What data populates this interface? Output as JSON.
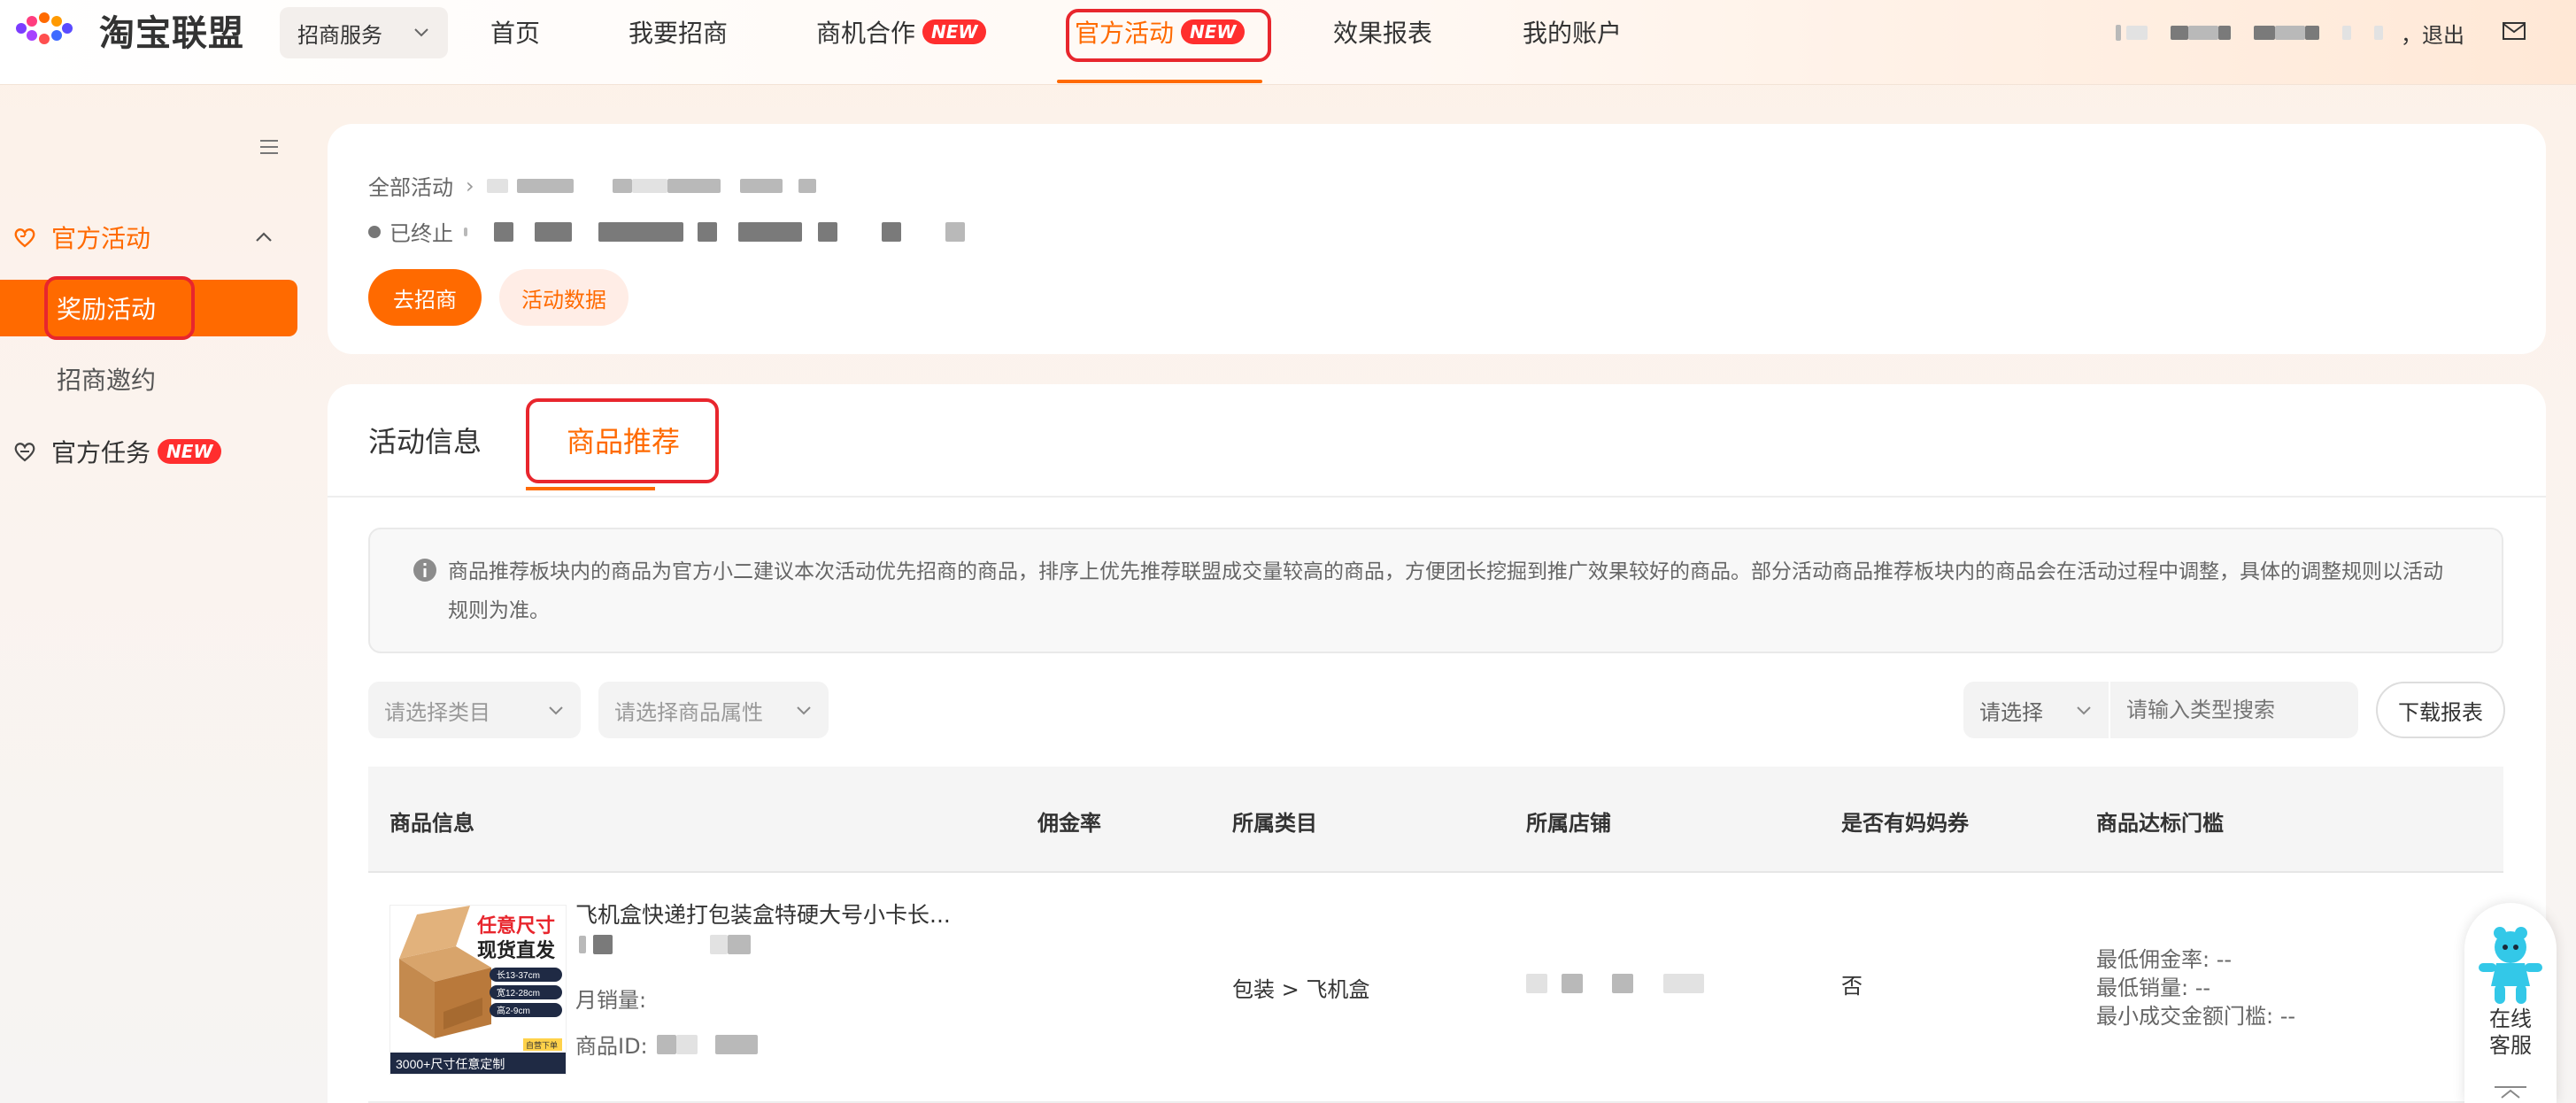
{
  "header": {
    "logo_text": "淘宝联盟",
    "service_select": "招商服务",
    "nav": [
      {
        "label": "首页"
      },
      {
        "label": "我要招商"
      },
      {
        "label": "商机合作",
        "badge": "NEW"
      },
      {
        "label": "官方活动",
        "badge": "NEW"
      },
      {
        "label": "效果报表"
      },
      {
        "label": "我的账户"
      }
    ],
    "logout": "，退出"
  },
  "sidebar": {
    "groups": [
      {
        "label": "官方活动",
        "items": [
          "奖励活动",
          "招商邀约"
        ]
      },
      {
        "label": "官方任务",
        "badge": "NEW"
      }
    ]
  },
  "activity": {
    "breadcrumb_root": "全部活动",
    "status": "已终止",
    "primary_button": "去招商",
    "secondary_button": "活动数据"
  },
  "tabs": [
    "活动信息",
    "商品推荐"
  ],
  "notice": "商品推荐板块内的商品为官方小二建议本次活动优先招商的商品，排序上优先推荐联盟成交量较高的商品，方便团长挖掘到推广效果较好的商品。部分活动商品推荐板块内的商品会在活动过程中调整，具体的调整规则以活动规则为准。",
  "filters": {
    "category_placeholder": "请选择类目",
    "attribute_placeholder": "请选择商品属性",
    "type_select": "请选择",
    "search_placeholder": "请输入类型搜索",
    "download_button": "下载报表"
  },
  "table": {
    "headers": [
      "商品信息",
      "佣金率",
      "所属类目",
      "所属店铺",
      "是否有妈妈券",
      "商品达标门槛"
    ],
    "rows": [
      {
        "title": "飞机盒快递打包装盒特硬大号小卡长...",
        "monthly_sales_label": "月销量:",
        "id_label": "商品ID:",
        "category": "包装 > 飞机盒",
        "has_coupon": "否",
        "thresholds": [
          "最低佣金率: --",
          "最低销量: --",
          "最小成交金额门槛: --"
        ],
        "thumb_text": {
          "headline1": "任意尺寸",
          "headline2": "现货直发",
          "specs": [
            "长13-37cm",
            "宽12-28cm",
            "高2-9cm"
          ],
          "footer": "3000+尺寸任意定制",
          "tag": "自营下单"
        }
      }
    ]
  },
  "customer_service": {
    "label_line1": "在线",
    "label_line2": "客服"
  },
  "colors": {
    "accent": "#ff6a00",
    "badge": "#ff2e2e",
    "annotation": "#e8262d"
  }
}
